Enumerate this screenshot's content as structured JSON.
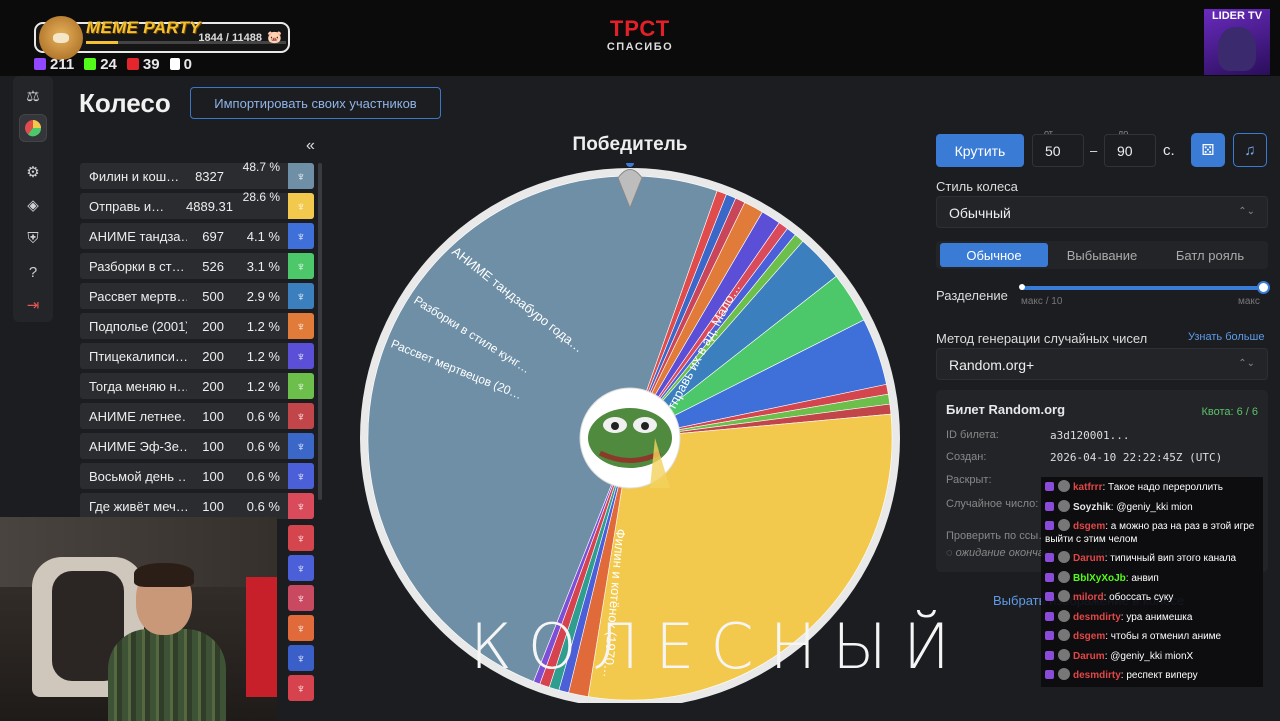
{
  "top": {
    "meme_title": "MEME PARTY",
    "meme_count": "1844 / 11488",
    "meme_progress": 0.16,
    "stats": [
      {
        "icon": "twitch-icon",
        "color": "#9146ff",
        "value": "211"
      },
      {
        "icon": "kick-icon",
        "color": "#53fc18",
        "value": "24"
      },
      {
        "icon": "live-icon",
        "color": "#e3262d",
        "value": "39"
      },
      {
        "icon": "w-icon",
        "color": "#ffffff",
        "value": "0"
      }
    ],
    "brand_title": "ТРСТ",
    "brand_sub": "СПАСИБО",
    "lider": "LIDER TV"
  },
  "page": {
    "title": "Колесо",
    "import_button": "Импортировать своих участников",
    "collapse": "«"
  },
  "participants": [
    {
      "name": "Филин и кош…",
      "amount": "8327",
      "pct": "48.7 %",
      "color": "#6e8fa6"
    },
    {
      "name": "Отправь и…",
      "amount": "4889.31",
      "pct": "28.6 %",
      "color": "#f2c94c"
    },
    {
      "name": "АНИМЕ тандза…",
      "amount": "697",
      "pct": "4.1 %",
      "color": "#3f6fd8"
    },
    {
      "name": "Разборки в ст…",
      "amount": "526",
      "pct": "3.1 %",
      "color": "#4cc76a"
    },
    {
      "name": "Рассвет мертв…",
      "amount": "500",
      "pct": "2.9 %",
      "color": "#3c7fbf"
    },
    {
      "name": "Подполье (2001)",
      "amount": "200",
      "pct": "1.2 %",
      "color": "#e07b39"
    },
    {
      "name": "Птицекалипси…",
      "amount": "200",
      "pct": "1.2 %",
      "color": "#5a4fd6"
    },
    {
      "name": "Тогда меняю н…",
      "amount": "200",
      "pct": "1.2 %",
      "color": "#6cbf4a"
    },
    {
      "name": "АНИМЕ летнее…",
      "amount": "100",
      "pct": "0.6 %",
      "color": "#c2454a"
    },
    {
      "name": "АНИМЕ Эф-Зе…",
      "amount": "100",
      "pct": "0.6 %",
      "color": "#3b67c9"
    },
    {
      "name": "Восьмой день …",
      "amount": "100",
      "pct": "0.6 %",
      "color": "#4a5fd8"
    },
    {
      "name": "Где живёт меч…",
      "amount": "100",
      "pct": "0.6 %",
      "color": "#d94a5a"
    }
  ],
  "extra_swatches": [
    "#d4454e",
    "#4a5fd8",
    "#c94a60",
    "#e06a3a",
    "#3b5fc9",
    "#d6434f"
  ],
  "wheel": {
    "winner_label": "Победитель",
    "labels": [
      "Отправь их в ад, Мало…",
      "АНИМЕ тандзабуро года…",
      "Разборки в стиле кунг…",
      "Рассвет мертвецов (20…",
      "Филин и котёнок (1970…"
    ]
  },
  "overlay": "КОЛЕСНЫЙ",
  "right": {
    "spin": "Крутить",
    "from_label": "от",
    "from": "50",
    "to_label": "до",
    "to": "90",
    "sec": "с.",
    "style_label": "Стиль колеса",
    "style_value": "Обычный",
    "modes": [
      "Обычное",
      "Выбывание",
      "Батл рояль"
    ],
    "split_label": "Разделение",
    "split_min": "макс / 10",
    "split_max": "макс",
    "rng_label": "Метод генерации случайных чисел",
    "learn_more": "Узнать больше",
    "rng_value": "Random.org+",
    "ticket_title": "Билет Random.org",
    "quota": "Квота: 6 / 6",
    "ticket_id_k": "ID билета:",
    "ticket_id_v": "a3d120001...",
    "created_k": "Создан:",
    "created_v": "2026-04-10 22:22:45Z (UTC)",
    "revealed_k": "Раскрыт:",
    "random_k": "Случайное число:",
    "check": "Проверить по ссы…",
    "waiting": "ожидание окончания вращения",
    "pick_image": "Выбрать изображение в колесе"
  },
  "chat": [
    {
      "user": "katfrrr",
      "color": "#e24747",
      "text": "Такое надо перероллить"
    },
    {
      "user": "Soyzhik",
      "color": "#e6e6e6",
      "text": "@geniy_kki mion"
    },
    {
      "user": "dsgem",
      "color": "#e24747",
      "text": "а можно раз на раз в этой игре выйти с этим челом"
    },
    {
      "user": "Darum",
      "color": "#e24747",
      "text": "типичный вип этого канала"
    },
    {
      "user": "BblXyXoJb",
      "color": "#53fc18",
      "text": "анвип"
    },
    {
      "user": "milord",
      "color": "#e24747",
      "text": "обоссать суку"
    },
    {
      "user": "desmdirty",
      "color": "#e24747",
      "text": "ура анимешка"
    },
    {
      "user": "dsgem",
      "color": "#e24747",
      "text": "чтобы я отменил аниме"
    },
    {
      "user": "Darum",
      "color": "#e24747",
      "text": "@geniy_kki mionX"
    },
    {
      "user": "desmdirty",
      "color": "#e24747",
      "text": "респект виперу"
    }
  ]
}
